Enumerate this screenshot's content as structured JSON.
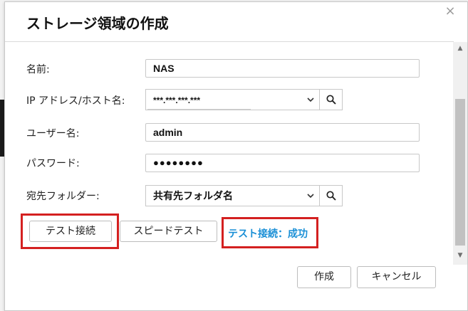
{
  "dialog": {
    "title": "ストレージ領域の作成",
    "close_symbol": "×"
  },
  "form": {
    "name_label": "名前:",
    "name_value": "NAS",
    "host_label": "IP アドレス/ホスト名:",
    "host_value": "***.***.***.***",
    "user_label": "ユーザー名:",
    "user_value": "admin",
    "password_label": "パスワード:",
    "password_value": "●●●●●●●●",
    "folder_label": "宛先フォルダー:",
    "folder_value": "共有先フォルダ名"
  },
  "actions": {
    "test_connection": "テスト接続",
    "speed_test": "スピードテスト",
    "status": "テスト接続：成功",
    "create": "作成",
    "cancel": "キャンセル"
  },
  "icons": {
    "search": "search-icon",
    "chevron": "chevron-down-icon",
    "close": "close-icon"
  },
  "colors": {
    "highlight": "#d42020",
    "status": "#1a8fd6"
  }
}
